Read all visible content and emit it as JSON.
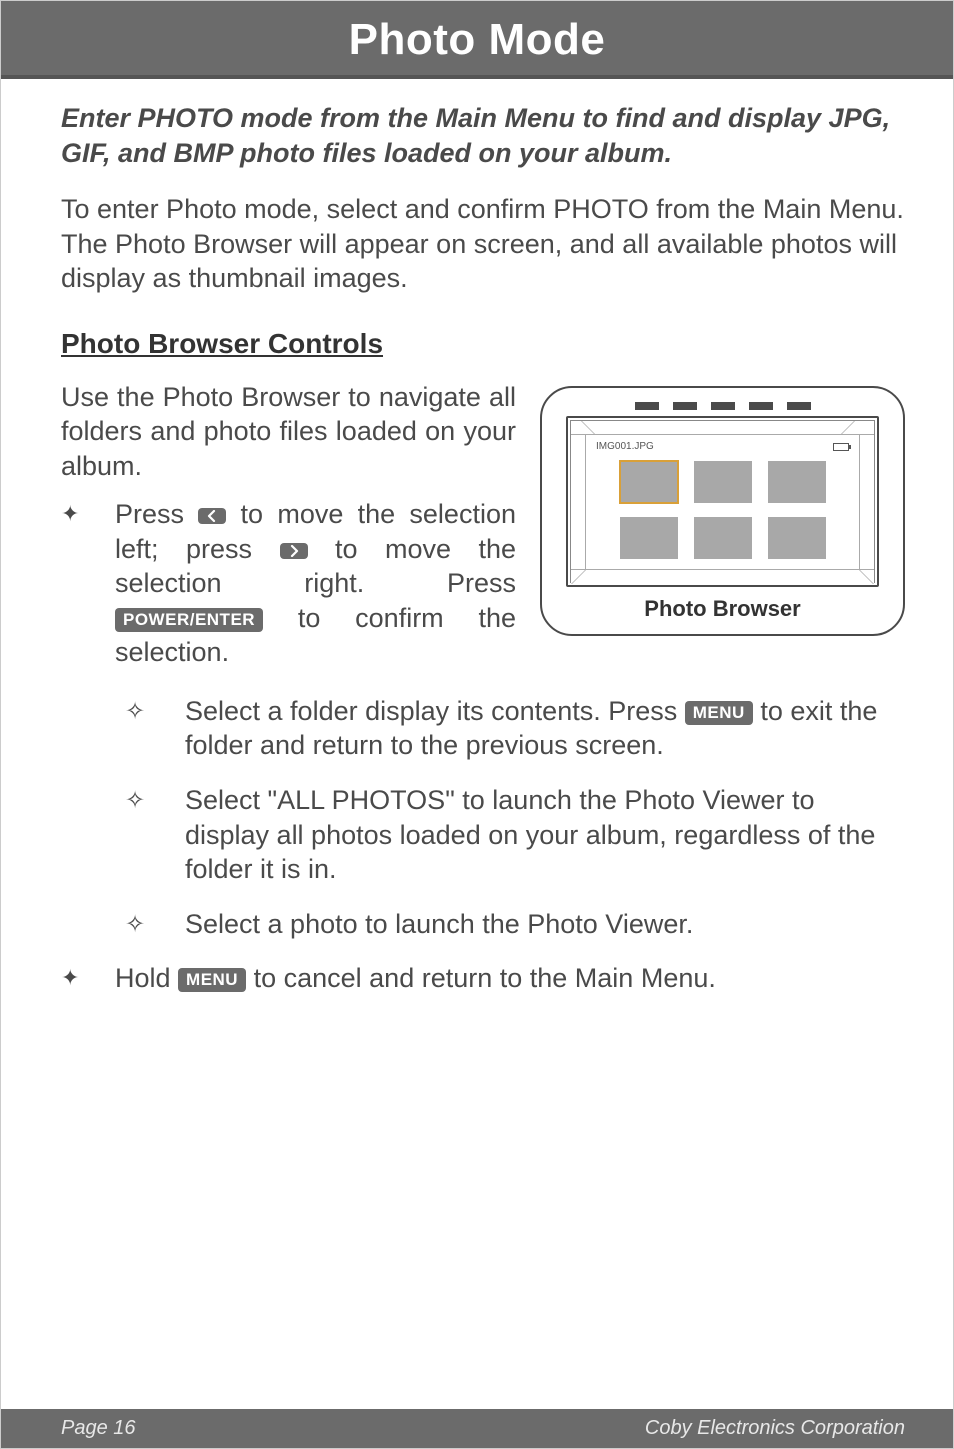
{
  "title": "Photo Mode",
  "intro_bold": "Enter PHOTO mode from the Main Menu to find and display JPG, GIF, and BMP photo files loaded on your album.",
  "intro_text": "To enter Photo mode, select and confirm PHOTO from the Main Menu. The Photo Browser will appear on screen, and all available photos will display as thumbnail images.",
  "section_heading": "Photo Browser Controls",
  "browser_intro": "Use the Photo Browser to navigate all folders and photo files loaded on your album.",
  "bullet1": {
    "p1a": "Press ",
    "p1b": " to move the selection left; press ",
    "p1c": " to move the selection right. Press ",
    "p1d": " to confirm the selection."
  },
  "sub_bullets": {
    "s1a": "Select a folder display its contents. Press ",
    "s1b": " to exit the folder and return to the previous screen.",
    "s2": "Select \"ALL PHOTOS\" to launch the Photo Viewer to display all photos loaded on your album, regardless of the folder it is in.",
    "s3": "Select a photo to launch the Photo Viewer."
  },
  "bullet2a": "Hold ",
  "bullet2b": " to cancel and return to the Main Menu.",
  "keys": {
    "left": "<",
    "right": ">",
    "power_enter": "POWER/ENTER",
    "menu": "MENU"
  },
  "illustration": {
    "filename": "IMG001.JPG",
    "caption": "Photo Browser"
  },
  "footer": {
    "left": "Page 16",
    "right": "Coby Electronics Corporation"
  }
}
